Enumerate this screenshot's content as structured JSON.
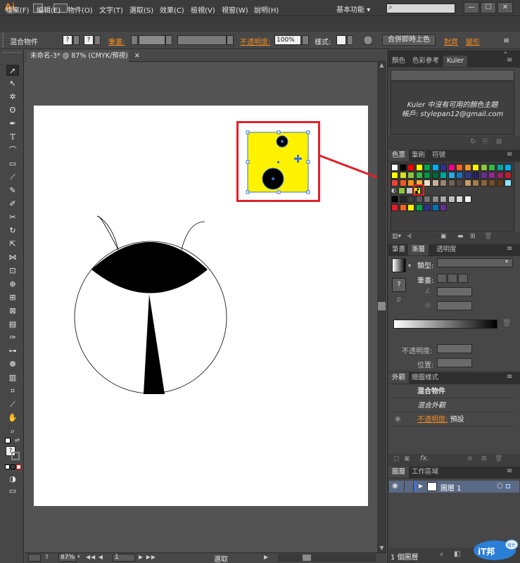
{
  "app": {
    "logo": "Ai"
  },
  "menu": [
    "檔案(F)",
    "編輯(E)",
    "物件(O)",
    "文字(T)",
    "選取(S)",
    "效果(C)",
    "檢視(V)",
    "視窗(W)",
    "說明(H)"
  ],
  "workspace": {
    "label": "基本功能",
    "chevron": "▾"
  },
  "search": {
    "placeholder": ""
  },
  "window_buttons": [
    "—",
    "☐",
    "✕"
  ],
  "control_bar": {
    "object_type": "混合物件",
    "fill_swatch": "?",
    "stroke_swatch": "?",
    "stroke_label": "筆畫:",
    "opacity_label": "不透明度:",
    "opacity_value": "100%",
    "style_label": "樣式:",
    "merge_button": "合併即時上色",
    "align_label": "對齊",
    "transform_label": "變形"
  },
  "document": {
    "tab_title": "未命名-3* @ 87% (CMYK/預視)",
    "close": "✕"
  },
  "status_bar": {
    "zoom": "87%",
    "page": "1",
    "status": "選取"
  },
  "panels": {
    "kuler": {
      "tabs": [
        "顏色",
        "色彩參考",
        "Kuler"
      ],
      "message_line1": "Kuler 中沒有可用的顏色主題",
      "message_line2": "帳戶: stylepan12@gmail.com"
    },
    "swatches": {
      "tabs": [
        "色票",
        "筆刷",
        "符號"
      ],
      "row1": [
        "#ffffff",
        "#000000",
        "#ff0000",
        "#ffff00",
        "#00a651",
        "#00aeef",
        "#2e3192",
        "#ec008c",
        "#f26522",
        "#f7941d",
        "#fff200",
        "#8dc63f",
        "#39b54a",
        "#00a99d",
        "#00aeef"
      ],
      "row2": [
        "#ffff00",
        "#d7df23",
        "#8dc63f",
        "#39b54a",
        "#009444",
        "#006838",
        "#00a99d",
        "#27aae1",
        "#1c75bc",
        "#2b3990",
        "#262262",
        "#662d91",
        "#92278f",
        "#9e1f63",
        "#be1e2d"
      ],
      "row3": [
        "#ef4136",
        "#f15a29",
        "#f7941d",
        "#fbb040",
        "#ede1c4",
        "#c7b299",
        "#998675",
        "#736357",
        "#534741",
        "#c69c6d",
        "#a67c52",
        "#8c6239",
        "#754c24",
        "#603813",
        "#8ae6ff"
      ],
      "row5": [
        "#000000",
        "#262626",
        "#404040",
        "#595959",
        "#737373",
        "#8c8c8c",
        "#a6a6a6",
        "#bfbfbf",
        "#d9d9d9",
        "#f2f2f2"
      ],
      "row6": [
        "#ed1c24",
        "#f26522",
        "#fff200",
        "#00a651",
        "#2e3192",
        "#0072bc",
        "#662d91"
      ]
    },
    "gradient": {
      "tabs": [
        "筆畫",
        "漸層",
        "透明度"
      ],
      "type_label": "類型:",
      "stroke_label": "筆畫:",
      "opacity_label": "不透明度:",
      "position_label": "位置:"
    },
    "appearance": {
      "tabs": [
        "外觀",
        "繪圖樣式"
      ],
      "rows": [
        "混合物件",
        "混合外觀"
      ],
      "opacity_label": "不透明度:",
      "opacity_value": "預設",
      "fx": "fx."
    },
    "layers": {
      "tabs": [
        "圖層",
        "工作區域"
      ],
      "layer_name": "圖層 1",
      "count": "1 個圖層"
    }
  },
  "watermark": {
    "text": "iT邦",
    "sub": "幫忙"
  },
  "colors": {
    "highlight": "#e0222a",
    "accent": "#f08a24",
    "selection": "#3a73d9",
    "yellow": "#fff200"
  }
}
